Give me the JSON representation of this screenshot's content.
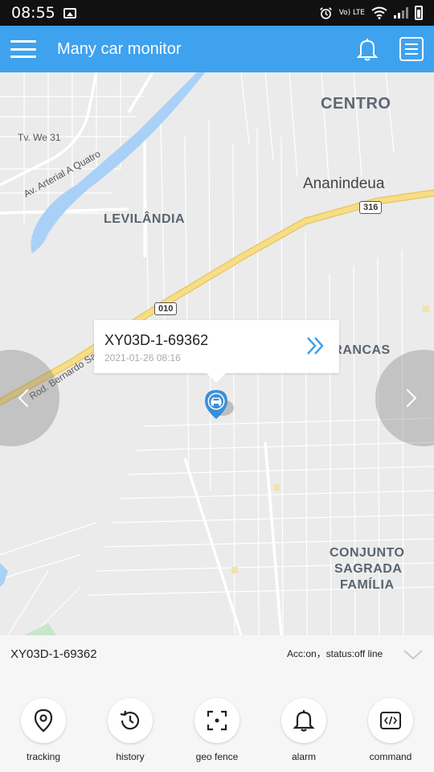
{
  "status_bar": {
    "time": "08:55",
    "network": "Vo) LTE"
  },
  "app_bar": {
    "title": "Many car monitor",
    "icons": [
      "menu-icon",
      "bell-icon",
      "list-icon"
    ]
  },
  "map": {
    "labels": {
      "centro": "CENTRO",
      "ananindeua": "Ananindeua",
      "levilandia": "LEVILÂNDIA",
      "aguas_brancas": "ÁGUAS BRANCAS",
      "conjunto_1": "CONJUNTO",
      "conjunto_2": "SAGRADA",
      "conjunto_3": "FAMÍLIA",
      "tv_we_31": "Tv. We 31",
      "av_arterial": "Av. Arterial A Quatro",
      "rod_bernardo": "Rod. Bernardo Sa"
    },
    "shields": {
      "route_316": "316",
      "route_010": "010"
    },
    "colors": {
      "road_highway": "#f5d77b",
      "water": "#a9d1f7",
      "accent": "#3ea2ef"
    }
  },
  "popup": {
    "vehicle_name": "XY03D-1-69362",
    "timestamp": "2021-01-26 08:16",
    "icon": "double-chevron-right-icon"
  },
  "panel": {
    "vehicle_name": "XY03D-1-69362",
    "status": "Acc:on，status:off line",
    "actions": [
      {
        "label": "tracking",
        "icon": "location-pin-icon"
      },
      {
        "label": "history",
        "icon": "history-clock-icon"
      },
      {
        "label": "geo fence",
        "icon": "geo-fence-icon"
      },
      {
        "label": "alarm",
        "icon": "bell-icon"
      },
      {
        "label": "command",
        "icon": "code-icon"
      }
    ]
  }
}
